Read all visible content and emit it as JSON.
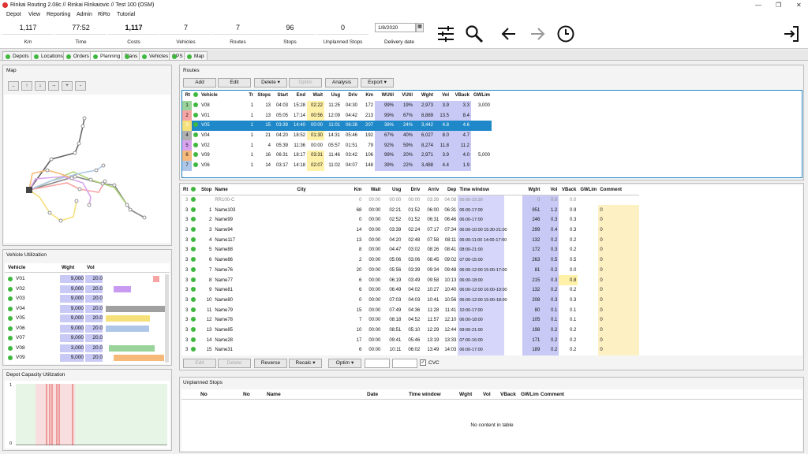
{
  "window": {
    "title": "Rinkai Routing 2.08c // Rinkai Rinkaiovic // Test 100 (OSM)",
    "min": "—",
    "max": "❐",
    "close": "✕"
  },
  "menu": [
    "Depot",
    "View",
    "Reporting",
    "Admin",
    "RiRo",
    "Tutorial"
  ],
  "stats": [
    {
      "v": "1,117",
      "l": "Km"
    },
    {
      "v": "77:52",
      "l": "Time"
    },
    {
      "v": "1,117",
      "l": "Costs"
    },
    {
      "v": "7",
      "l": "Vehicles"
    },
    {
      "v": "7",
      "l": "Routes"
    },
    {
      "v": "96",
      "l": "Stops"
    },
    {
      "v": "0",
      "l": "Unplanned Stops"
    }
  ],
  "delivery": {
    "date": "1/8/2020",
    "label": "Delivery date",
    "cal": "▦"
  },
  "icons": [
    "filter-sliders-icon",
    "search-icon",
    "back-arrow-icon",
    "forward-arrow-icon",
    "clock-icon",
    "logout-icon"
  ],
  "tabs": [
    "Depots",
    "Locations",
    "Orders",
    "Planning",
    "Plans",
    "Vehicles",
    "GPS",
    "Map"
  ],
  "map": {
    "title": "Map",
    "buttons": [
      "..",
      "↑",
      "↓",
      "→",
      "+",
      "-"
    ]
  },
  "vu": {
    "title": "Vehicle Utilization",
    "cols": [
      "Vehicle",
      "Wght",
      "Vol"
    ],
    "rows": [
      [
        "V01",
        "9,000",
        "20.0"
      ],
      [
        "V02",
        "9,000",
        "20.0"
      ],
      [
        "V03",
        "9,000",
        "20.0"
      ],
      [
        "V04",
        "9,000",
        "20.0"
      ],
      [
        "V05",
        "9,000",
        "20.0"
      ],
      [
        "V06",
        "9,000",
        "20.0"
      ],
      [
        "V07",
        "9,000",
        "20.0"
      ],
      [
        "V08",
        "3,000",
        "20.0"
      ],
      [
        "V09",
        "9,000",
        "20.0"
      ]
    ]
  },
  "depotcap": {
    "title": "Depot Capacity Utilization",
    "y1": "1",
    "y0": "0"
  },
  "routes": {
    "title": "Routes",
    "buttons": [
      "Add",
      "Edit",
      "Delete ▾",
      "Optim",
      "Analysis",
      "Export ▾"
    ],
    "cols": [
      "Rt",
      "",
      "Vehicle",
      "Tr",
      "Stops",
      "Start",
      "End",
      "Wait",
      "Usg",
      "Driv",
      "Km",
      "WUtil",
      "VUtil",
      "Wght",
      "Vol",
      "VBack",
      "GWLim"
    ],
    "rows": [
      [
        "1",
        "",
        "V08",
        "1",
        "13",
        "04:03",
        "15:28",
        "02:22",
        "11:25",
        "04:30",
        "172",
        "99%",
        "19%",
        "2,973",
        "3.9",
        "3.3",
        "3,000"
      ],
      [
        "2",
        "",
        "V01",
        "1",
        "13",
        "05:05",
        "17:14",
        "00:56",
        "12:09",
        "04:42",
        "213",
        "99%",
        "67%",
        "8,889",
        "13.5",
        "8.4",
        ""
      ],
      [
        "3",
        "",
        "V05",
        "1",
        "15",
        "03:39",
        "14:40",
        "00:00",
        "11:01",
        "06:28",
        "207",
        "38%",
        "24%",
        "3,442",
        "4.8",
        "4.6",
        ""
      ],
      [
        "4",
        "",
        "V04",
        "1",
        "21",
        "04:20",
        "18:52",
        "01:30",
        "14:31",
        "05:46",
        "192",
        "67%",
        "40%",
        "6,027",
        "8.0",
        "4.7",
        ""
      ],
      [
        "5",
        "",
        "V02",
        "1",
        "4",
        "05:39",
        "11:36",
        "00:00",
        "05:57",
        "01:51",
        "79",
        "92%",
        "59%",
        "8,274",
        "11.8",
        "11.2",
        ""
      ],
      [
        "6",
        "",
        "V09",
        "1",
        "16",
        "06:31",
        "18:17",
        "03:31",
        "11:46",
        "03:42",
        "106",
        "99%",
        "20%",
        "2,971",
        "3.9",
        "4.0",
        "5,000"
      ],
      [
        "7",
        "",
        "V06",
        "1",
        "14",
        "03:17",
        "14:18",
        "02:07",
        "11:02",
        "04:07",
        "148",
        "39%",
        "22%",
        "3,488",
        "4.4",
        "1.9",
        ""
      ]
    ]
  },
  "stops": {
    "cols": [
      "Rt",
      "",
      "Stop",
      "Name",
      "City",
      "Km",
      "Wait",
      "Usg",
      "Driv",
      "Arriv",
      "Dep",
      "Time window",
      "Wght",
      "Vol",
      "VBack",
      "GWLim",
      "Comment"
    ],
    "rows": [
      [
        "3",
        "",
        "",
        "RR100-C",
        "",
        "0",
        "00:00",
        "00:00",
        "00:00",
        "03:39",
        "04:08",
        "00:00-23:30",
        "0",
        "0.0",
        "0.0",
        "",
        ""
      ],
      [
        "3",
        "",
        "1",
        "Name103",
        "",
        "68",
        "00:00",
        "02:21",
        "01:52",
        "06:00",
        "06:31",
        "06:00-17:00",
        "951",
        "1.2",
        "0.9",
        "",
        "0"
      ],
      [
        "3",
        "",
        "2",
        "Name99",
        "",
        "0",
        "00:00",
        "02:52",
        "01:52",
        "06:31",
        "06:46",
        "06:00-17:00",
        "246",
        "0.3",
        "0.3",
        "",
        "0"
      ],
      [
        "3",
        "",
        "3",
        "Name94",
        "",
        "14",
        "00:00",
        "03:39",
        "02:24",
        "07:17",
        "07:34",
        "06:00-10:00 15:30-21:00",
        "299",
        "0.4",
        "0.3",
        "",
        "0"
      ],
      [
        "3",
        "",
        "4",
        "Name117",
        "",
        "13",
        "00:00",
        "04:20",
        "02:48",
        "07:58",
        "08:11",
        "06:00-11:00 14:00-17:00",
        "132",
        "0.2",
        "0.2",
        "",
        "0"
      ],
      [
        "3",
        "",
        "5",
        "Name88",
        "",
        "8",
        "00:00",
        "04:47",
        "03:02",
        "08:26",
        "08:41",
        "08:00-21:00",
        "172",
        "0.3",
        "0.2",
        "",
        "0"
      ],
      [
        "3",
        "",
        "6",
        "Name86",
        "",
        "2",
        "00:00",
        "05:06",
        "03:06",
        "08:45",
        "09:02",
        "07:00-15:00",
        "263",
        "0.5",
        "0.5",
        "",
        "0"
      ],
      [
        "3",
        "",
        "7",
        "Name76",
        "",
        "20",
        "00:00",
        "05:56",
        "03:39",
        "09:34",
        "09:48",
        "06:00-12:00 15:00-17:00",
        "81",
        "0.2",
        "0.0",
        "",
        "0"
      ],
      [
        "3",
        "",
        "8",
        "Name77",
        "",
        "6",
        "00:00",
        "06:19",
        "03:49",
        "09:58",
        "10:13",
        "06:00-18:00",
        "215",
        "0.3",
        "0.8",
        "",
        "0"
      ],
      [
        "3",
        "",
        "9",
        "Name81",
        "",
        "6",
        "00:00",
        "06:49",
        "04:02",
        "10:27",
        "10:40",
        "06:00-12:00 16:00-19:00",
        "132",
        "0.2",
        "0.2",
        "",
        "0"
      ],
      [
        "3",
        "",
        "10",
        "Name80",
        "",
        "0",
        "00:00",
        "07:03",
        "04:03",
        "10:41",
        "10:56",
        "06:00-12:00 15:00-18:00",
        "208",
        "0.3",
        "0.3",
        "",
        "0"
      ],
      [
        "3",
        "",
        "11",
        "Name79",
        "",
        "15",
        "00:00",
        "07:49",
        "04:36",
        "11:28",
        "11:41",
        "10:00-17:00",
        "80",
        "0.1",
        "0.1",
        "",
        "0"
      ],
      [
        "3",
        "",
        "12",
        "Name78",
        "",
        "7",
        "00:00",
        "08:18",
        "04:52",
        "11:57",
        "12:10",
        "06:00-18:00",
        "105",
        "0.1",
        "0.1",
        "",
        "0"
      ],
      [
        "3",
        "",
        "13",
        "Name85",
        "",
        "10",
        "00:00",
        "08:51",
        "05:10",
        "12:29",
        "12:44",
        "09:00-21:00",
        "198",
        "0.2",
        "0.2",
        "",
        "0"
      ],
      [
        "3",
        "",
        "14",
        "Name28",
        "",
        "17",
        "00:00",
        "09:41",
        "05:46",
        "13:19",
        "13:33",
        "07:00-16:00",
        "171",
        "0.2",
        "0.2",
        "",
        "0"
      ],
      [
        "3",
        "",
        "15",
        "Name31",
        "",
        "6",
        "00:00",
        "10:11",
        "06:02",
        "13:49",
        "14:03",
        "06:00-17:00",
        "189",
        "0.2",
        "0.2",
        "",
        "0"
      ]
    ],
    "buttons": [
      "Edit",
      "Delete",
      "Reverse",
      "Recalc ▾",
      "Optim ▾"
    ],
    "cvc": "CVC",
    "check": "✓"
  },
  "unplanned": {
    "title": "Unplanned Stops",
    "cols": [
      "No",
      "No",
      "Name",
      "Date",
      "Time window",
      "Wght",
      "Vol",
      "VBack",
      "GWLim",
      "Comment"
    ],
    "empty": "No content in table"
  },
  "colors": {
    "accent": "#1e88c8",
    "green": "#3fb83f"
  }
}
